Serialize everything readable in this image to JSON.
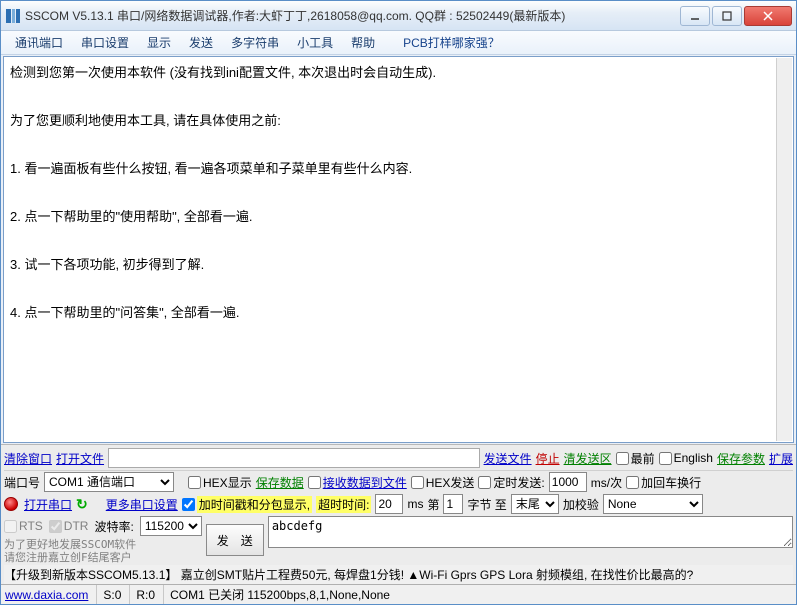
{
  "title": "SSCOM V5.13.1 串口/网络数据调试器,作者:大虾丁丁,2618058@qq.com. QQ群 : 52502449(最新版本)",
  "menu": [
    "通讯端口",
    "串口设置",
    "显示",
    "发送",
    "多字符串",
    "小工具",
    "帮助"
  ],
  "menu_promo": "PCB打样哪家强？",
  "maintext": "检测到您第一次使用本软件 (没有找到ini配置文件, 本次退出时会自动生成).\n\n为了您更顺利地使用本工具, 请在具体使用之前:\n\n1. 看一遍面板有些什么按钮, 看一遍各项菜单和子菜单里有些什么内容.\n\n2. 点一下帮助里的\"使用帮助\", 全部看一遍.\n\n3. 试一下各项功能, 初步得到了解.\n\n4. 点一下帮助里的\"问答集\", 全部看一遍.",
  "btns": {
    "clear": "清除窗口",
    "openfile": "打开文件",
    "sendfile": "发送文件",
    "stop": "停止",
    "clearsend": "清发送区",
    "front": "最前",
    "english": "English",
    "saveparam": "保存参数",
    "expand": "扩展",
    "savedata": "保存数据",
    "openport": "打开串口",
    "moreport": "更多串口设置",
    "send": "发　送"
  },
  "labels": {
    "port": "端口号",
    "hexshow": "HEX显示",
    "recvtofile": "接收数据到文件",
    "hexsend": "HEX发送",
    "timedsend": "定时发送:",
    "msper": "ms/次",
    "addcrlf": "加回车换行",
    "rts": "RTS",
    "dtr": "DTR",
    "baud": "波特率:",
    "timestamp": "加时间戳和分包显示,",
    "timeout": "超时时间:",
    "ms": "ms",
    "di": "第",
    "byte_to": "字节 至",
    "addcheck": "加校验"
  },
  "values": {
    "port_sel": "COM1 通信端口",
    "sendinterval": "1000",
    "baud": "115200",
    "timeout": "20",
    "pktstart": "1",
    "pktend_sel": "末尾",
    "check_sel": "None",
    "sendtext": "abcdefg",
    "dtr_checked": true,
    "timestamp_checked": true
  },
  "graytext": "为了更好地发展SSCOM软件\n请您注册嘉立创F结尾客户",
  "bottombar": "【升级到新版本SSCOM5.13.1】      嘉立创SMT贴片工程费50元, 每焊盘1分钱! ▲Wi-Fi Gprs GPS Lora 射频模组, 在找性价比最高的?",
  "status": {
    "url": "www.daxia.com",
    "s": "S:0",
    "r": "R:0",
    "info": "COM1 已关闭  115200bps,8,1,None,None"
  }
}
